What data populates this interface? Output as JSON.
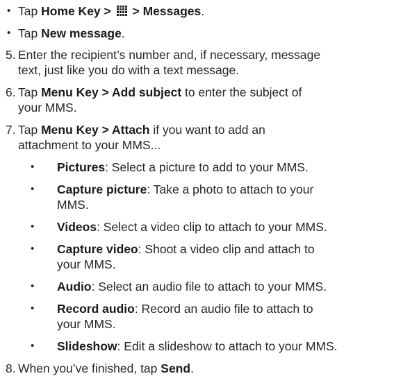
{
  "heading_partial": "",
  "steps": {
    "s1": {
      "bullet": "•",
      "pre": "Tap ",
      "b1": "Home Key >",
      "mid": " ",
      "b2": " > Messages",
      "post": "."
    },
    "s2": {
      "bullet": "•",
      "pre": "Tap ",
      "b1": "New message",
      "post": "."
    },
    "s5": {
      "num": "5.",
      "line1": "Enter the recipient’s number and, if necessary, message",
      "line2": "text, just like you do with a text message."
    },
    "s6": {
      "num": "6.",
      "pre": "Tap ",
      "b1": "Menu Key > Add subject",
      "post1": " to enter the subject of",
      "line2": "your MMS."
    },
    "s7": {
      "num": "7.",
      "pre": "Tap ",
      "b1": "Menu Key > Attach",
      "post1": " if you want to add an",
      "line2": "attachment to your MMS..."
    },
    "s8": {
      "num": "8.",
      "pre": "When you’ve finished, tap ",
      "b1": "Send",
      "post": "."
    }
  },
  "attach_options": [
    {
      "bullet": "•",
      "name": "Pictures",
      "desc1": ": Select a picture to add to your MMS.",
      "desc2": ""
    },
    {
      "bullet": "•",
      "name": "Capture picture",
      "desc1": ": Take a photo to attach to your",
      "desc2": "MMS."
    },
    {
      "bullet": "•",
      "name": "Videos",
      "desc1": ": Select a video clip to attach to your MMS.",
      "desc2": ""
    },
    {
      "bullet": "•",
      "name": "Capture video",
      "desc1": ": Shoot a video clip and attach to",
      "desc2": "your MMS."
    },
    {
      "bullet": "•",
      "name": "Audio",
      "desc1": ": Select an audio file to attach to your MMS.",
      "desc2": ""
    },
    {
      "bullet": "•",
      "name": "Record audio",
      "desc1": ": Record an audio file to attach to",
      "desc2": "your MMS."
    },
    {
      "bullet": "•",
      "name": "Slideshow",
      "desc1": ": Edit a slideshow to attach to your MMS.",
      "desc2": ""
    }
  ],
  "icons": {
    "apps": "apps-grid-icon"
  }
}
